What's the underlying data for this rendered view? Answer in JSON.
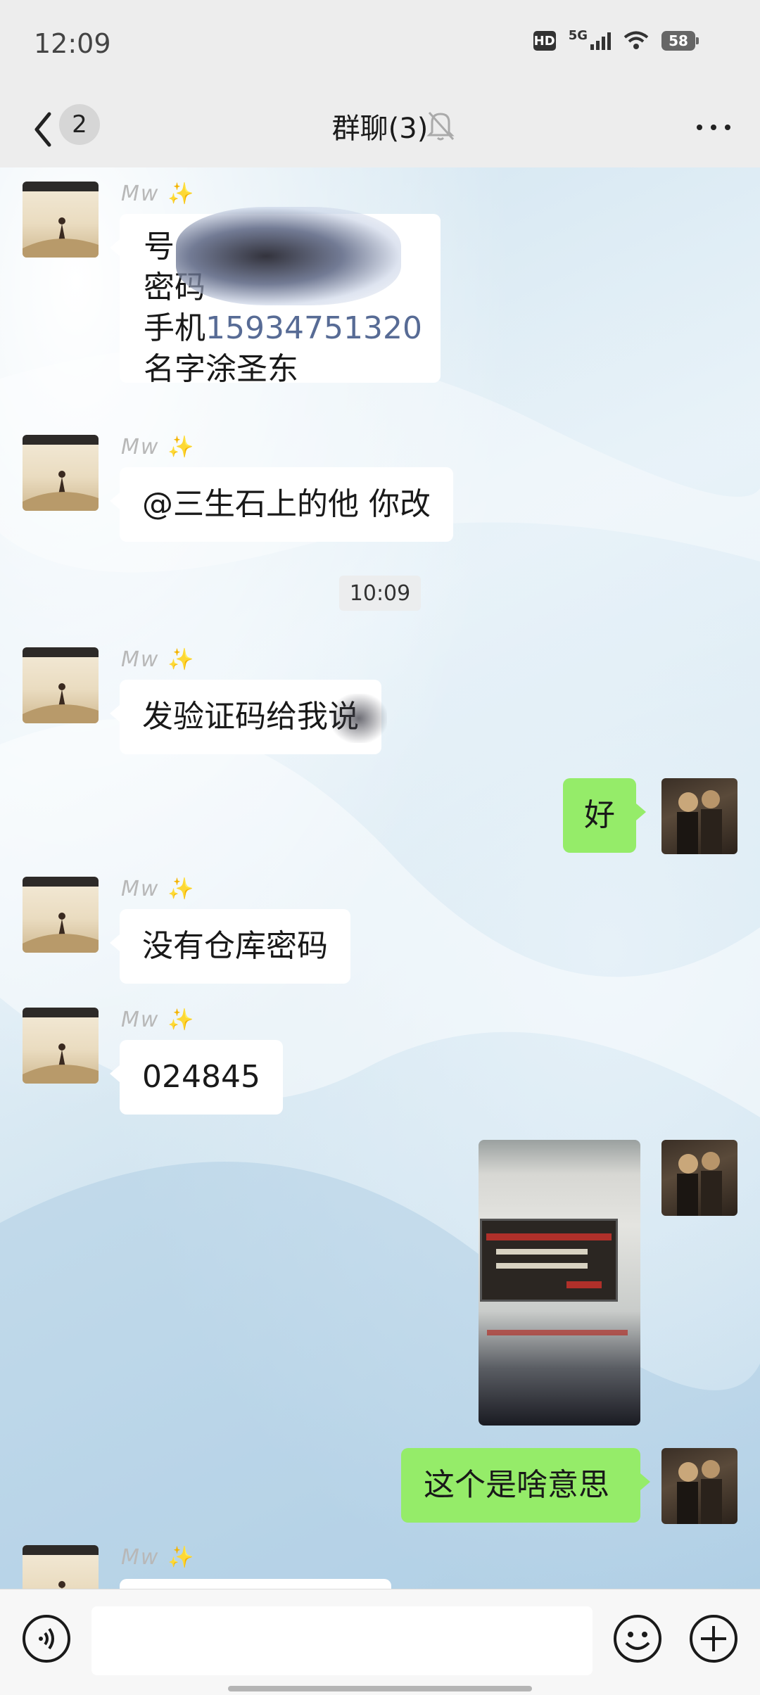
{
  "status_bar": {
    "time": "12:09",
    "hd_label": "HD",
    "network_label": "5G",
    "battery": "58"
  },
  "header": {
    "unread_count": "2",
    "title": "群聊(3)"
  },
  "messages": [
    {
      "sender": "left",
      "nickname": "Mw",
      "lines": [
        "号",
        "密码",
        "手机",
        "名字涂圣东"
      ],
      "phone": "15934751320"
    },
    {
      "sender": "left",
      "nickname": "Mw",
      "text": "@三生石上的他  你改"
    },
    {
      "timestamp": "10:09"
    },
    {
      "sender": "left",
      "nickname": "Mw",
      "text": "发验证码给我说"
    },
    {
      "sender": "self",
      "text": "好"
    },
    {
      "sender": "left",
      "nickname": "Mw",
      "text": "没有仓库密码"
    },
    {
      "sender": "left",
      "nickname": "Mw",
      "text": "024845"
    },
    {
      "sender": "self",
      "type": "image"
    },
    {
      "sender": "self",
      "text": "这个是啥意思"
    },
    {
      "sender": "left",
      "nickname": "Mw"
    }
  ],
  "icons": {
    "back": "chevron-left-icon",
    "mute": "bell-mute-icon",
    "more": "more-icon",
    "voice": "voice-icon",
    "emoji": "emoji-icon",
    "add": "plus-icon"
  },
  "colors": {
    "self_bubble": "#95ec69",
    "other_bubble": "#ffffff",
    "link": "#576b95"
  }
}
